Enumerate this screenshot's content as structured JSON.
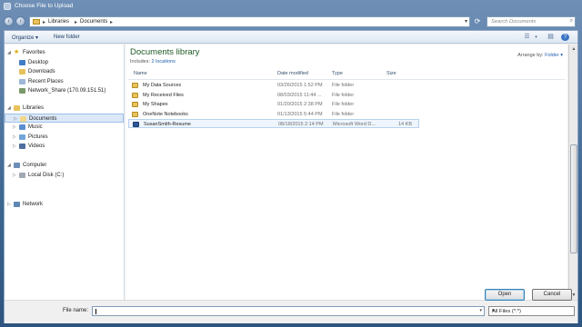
{
  "window": {
    "title": "Choose File to Upload"
  },
  "address": {
    "crumbs": [
      "Libraries",
      "Documents"
    ],
    "separator": "▸"
  },
  "search": {
    "placeholder": "Search Documents"
  },
  "toolbar": {
    "organize": "Organize ▾",
    "new_folder": "New folder"
  },
  "sidebar": {
    "favorites_label": "Favorites",
    "favorites": [
      "Desktop",
      "Downloads",
      "Recent Places",
      "Network_Share (170.09.151.51)"
    ],
    "libraries_label": "Libraries",
    "libraries": [
      "Documents",
      "Music",
      "Pictures",
      "Videos"
    ],
    "computer_label": "Computer",
    "computer": [
      "Local Disk (C:)"
    ],
    "network_label": "Network"
  },
  "library": {
    "title": "Documents library",
    "includes_label": "Includes:",
    "includes_link": "2 locations",
    "arrange_label": "Arrange by:",
    "arrange_value": "Folder ▾"
  },
  "columns": {
    "name": "Name",
    "date": "Date modified",
    "type": "Type",
    "size": "Size"
  },
  "files": [
    {
      "name": "My Data Sources",
      "date": "03/26/2015 1:52 PM",
      "type": "File folder",
      "size": ""
    },
    {
      "name": "My Received Files",
      "date": "08/03/2015 11:44 ...",
      "type": "File folder",
      "size": ""
    },
    {
      "name": "My Shapes",
      "date": "01/20/2015 2:38 PM",
      "type": "File folder",
      "size": ""
    },
    {
      "name": "OneNote Notebooks",
      "date": "01/13/2015 5:44 PM",
      "type": "File folder",
      "size": ""
    },
    {
      "name": "SusanSmith-Resume",
      "date": "08/18/2015 2:14 PM",
      "type": "Microsoft Word D...",
      "size": "14 KB"
    }
  ],
  "footer": {
    "file_name_label": "File name:",
    "file_name_value": "",
    "filter": "All Files (*.*)",
    "open": "Open",
    "cancel": "Cancel"
  },
  "colors": {
    "library_title": "#1e5a24",
    "link": "#1f5fae",
    "folder": "#e8c25c",
    "word_doc": "#2b5797"
  }
}
